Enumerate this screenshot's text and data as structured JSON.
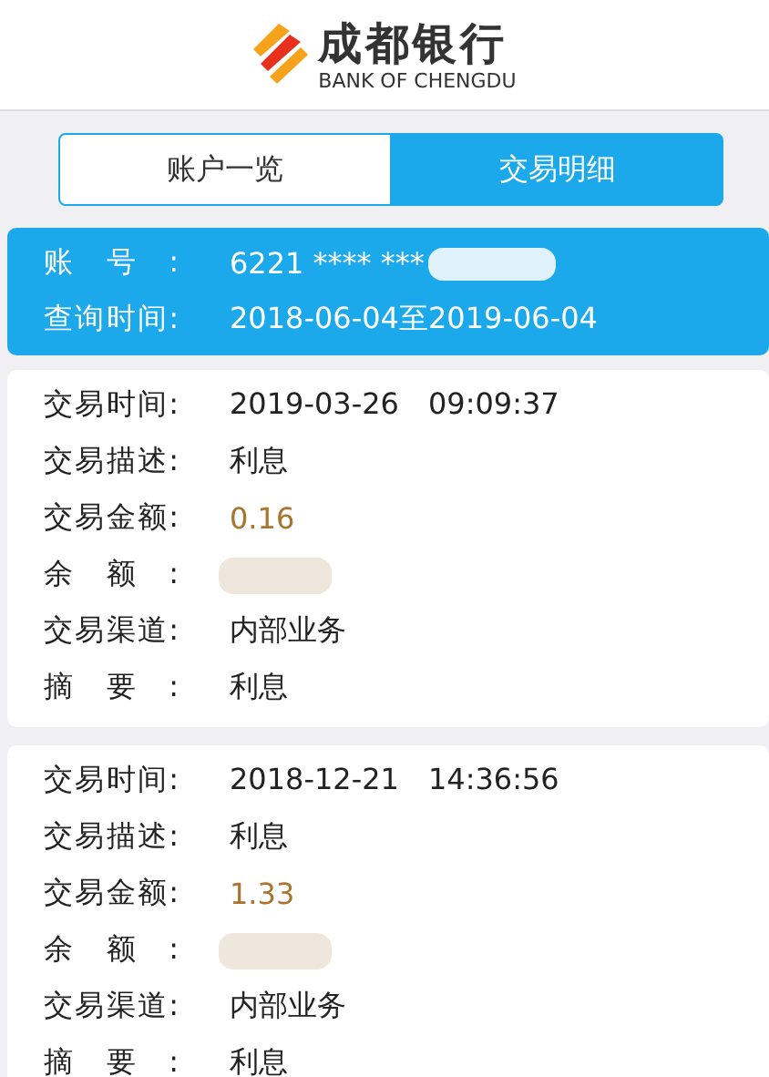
{
  "header": {
    "bank_name": "成都银行",
    "bank_name_en": "BANK OF CHENGDU"
  },
  "tabs": [
    {
      "label": "账户一览",
      "selected": false
    },
    {
      "label": "交易明细",
      "selected": true
    }
  ],
  "account": {
    "fields": [
      {
        "label": "账号:",
        "value": "6221 **** ***",
        "redacted": true
      },
      {
        "label": "查询时间:",
        "value": "2018-06-04至2019-06-04",
        "redacted": false
      }
    ]
  },
  "transactions": [
    {
      "fields": [
        {
          "label": "交易时间:",
          "kind": "text",
          "value": "2019-03-26　09:09:37"
        },
        {
          "label": "交易描述:",
          "kind": "text",
          "value": "利息"
        },
        {
          "label": "交易金额:",
          "kind": "amount",
          "value": "0.16"
        },
        {
          "label": "余额:",
          "kind": "redacted"
        },
        {
          "label": "交易渠道:",
          "kind": "text",
          "value": "内部业务"
        },
        {
          "label": "摘要:",
          "kind": "text",
          "value": "利息"
        }
      ]
    },
    {
      "fields": [
        {
          "label": "交易时间:",
          "kind": "text",
          "value": "2018-12-21　14:36:56"
        },
        {
          "label": "交易描述:",
          "kind": "text",
          "value": "利息"
        },
        {
          "label": "交易金额:",
          "kind": "amount",
          "value": "1.33"
        },
        {
          "label": "余额:",
          "kind": "redacted"
        },
        {
          "label": "交易渠道:",
          "kind": "text",
          "value": "内部业务"
        },
        {
          "label": "摘要:",
          "kind": "text",
          "value": "利息"
        }
      ]
    }
  ]
}
